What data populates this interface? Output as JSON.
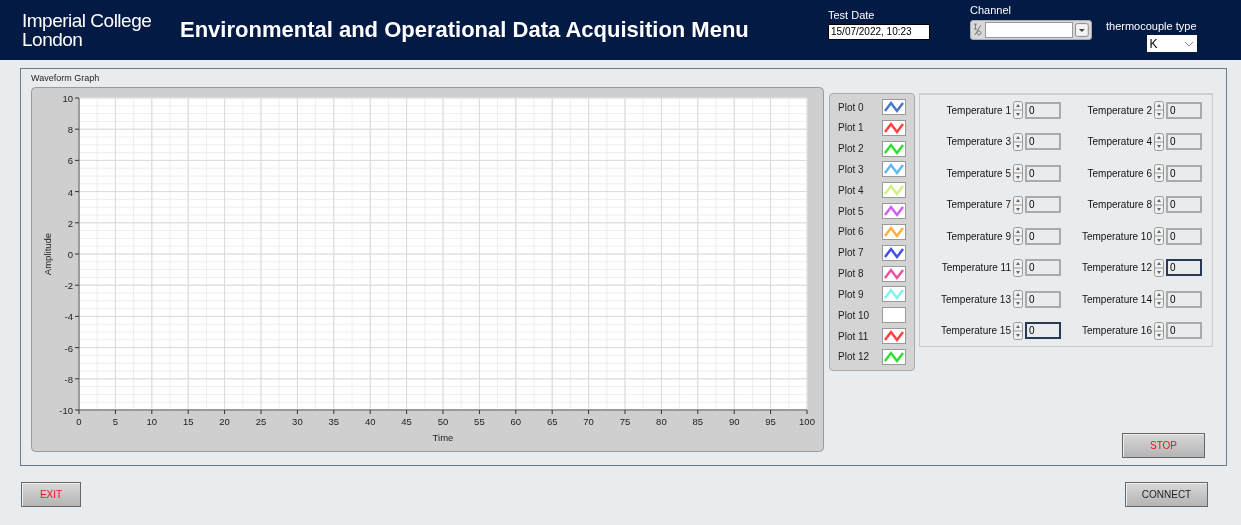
{
  "header": {
    "logo": [
      "Imperial College",
      "London"
    ],
    "title": "Environmental and Operational Data Acquisition Menu",
    "test_date": {
      "label": "Test Date",
      "value": "15/07/2022, 10:23"
    },
    "channel": {
      "label": "Channel"
    },
    "thermocouple_type": {
      "label": "thermocouple type",
      "value": "K"
    }
  },
  "graph": {
    "title": "Waveform Graph",
    "chart_data": {
      "type": "line",
      "xlabel": "Time",
      "ylabel": "Amplitude",
      "xlim": [
        0,
        100
      ],
      "ylim": [
        -10,
        10
      ],
      "xticks": [
        0,
        5,
        10,
        15,
        20,
        25,
        30,
        35,
        40,
        45,
        50,
        55,
        60,
        65,
        70,
        75,
        80,
        85,
        90,
        95,
        100
      ],
      "yticks": [
        -10,
        -8,
        -6,
        -4,
        -2,
        0,
        2,
        4,
        6,
        8,
        10
      ],
      "grid": true
    }
  },
  "legend": [
    {
      "label": "Plot 0",
      "color": "#4a78c8"
    },
    {
      "label": "Plot 1",
      "color": "#ff4040"
    },
    {
      "label": "Plot 2",
      "color": "#30e030"
    },
    {
      "label": "Plot 3",
      "color": "#60b8f0"
    },
    {
      "label": "Plot 4",
      "color": "#d0f080"
    },
    {
      "label": "Plot 5",
      "color": "#d060f0"
    },
    {
      "label": "Plot 6",
      "color": "#f8b040"
    },
    {
      "label": "Plot 7",
      "color": "#4050e8"
    },
    {
      "label": "Plot 8",
      "color": "#f050a0"
    },
    {
      "label": "Plot 9",
      "color": "#80f0f0"
    },
    {
      "label": "Plot 10",
      "color": "#ffffff"
    },
    {
      "label": "Plot 11",
      "color": "#ff4040"
    },
    {
      "label": "Plot 12",
      "color": "#30e030"
    }
  ],
  "temperatures": [
    {
      "label": "Temperature 1",
      "value": "0",
      "focused": false
    },
    {
      "label": "Temperature 2",
      "value": "0",
      "focused": false
    },
    {
      "label": "Temperature 3",
      "value": "0",
      "focused": false
    },
    {
      "label": "Temperature 4",
      "value": "0",
      "focused": false
    },
    {
      "label": "Temperature 5",
      "value": "0",
      "focused": false
    },
    {
      "label": "Temperature 6",
      "value": "0",
      "focused": false
    },
    {
      "label": "Temperature 7",
      "value": "0",
      "focused": false
    },
    {
      "label": "Temperature 8",
      "value": "0",
      "focused": false
    },
    {
      "label": "Temperature 9",
      "value": "0",
      "focused": false
    },
    {
      "label": "Temperature 10",
      "value": "0",
      "focused": false
    },
    {
      "label": "Temperature 11",
      "value": "0",
      "focused": false
    },
    {
      "label": "Temperature 12",
      "value": "0",
      "focused": true
    },
    {
      "label": "Temperature 13",
      "value": "0",
      "focused": false
    },
    {
      "label": "Temperature 14",
      "value": "0",
      "focused": false
    },
    {
      "label": "Temperature 15",
      "value": "0",
      "focused": true
    },
    {
      "label": "Temperature 16",
      "value": "0",
      "focused": false
    }
  ],
  "buttons": {
    "stop": "STOP",
    "exit": "EXIT",
    "connect": "CONNECT"
  }
}
